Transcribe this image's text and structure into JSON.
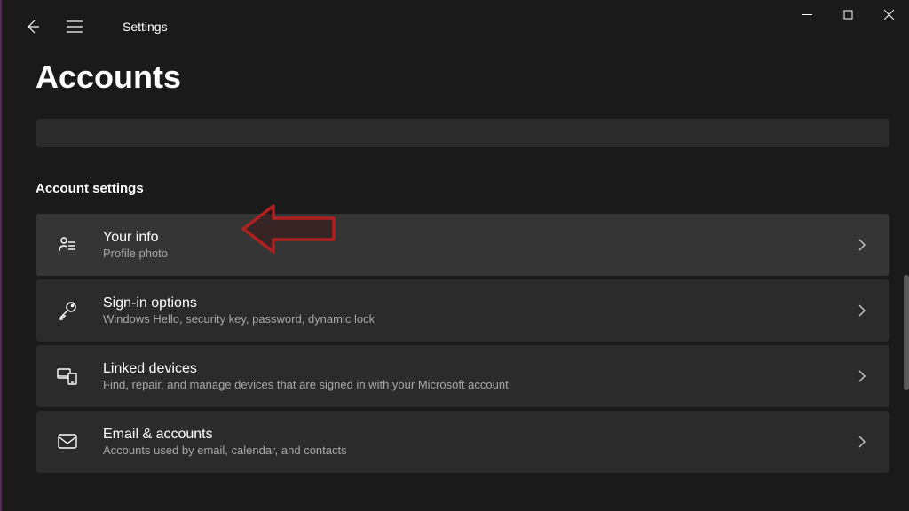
{
  "window": {
    "app_title": "Settings",
    "minimize": "−",
    "maximize": "□",
    "close": "×"
  },
  "page": {
    "heading": "Accounts"
  },
  "section": {
    "title": "Account settings"
  },
  "cards": {
    "your_info": {
      "title": "Your info",
      "subtitle": "Profile photo"
    },
    "signin": {
      "title": "Sign-in options",
      "subtitle": "Windows Hello, security key, password, dynamic lock"
    },
    "linked": {
      "title": "Linked devices",
      "subtitle": "Find, repair, and manage devices that are signed in with your Microsoft account"
    },
    "email": {
      "title": "Email & accounts",
      "subtitle": "Accounts used by email, calendar, and contacts"
    }
  },
  "annotation": {
    "arrow_color": "#8b1a1a"
  }
}
